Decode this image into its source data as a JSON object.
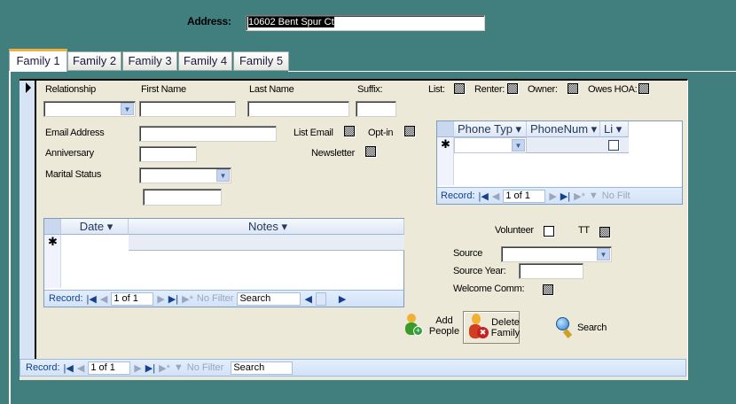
{
  "address": {
    "label": "Address:",
    "value": "10602 Bent Spur Ct"
  },
  "tabs": [
    "Family 1",
    "Family 2",
    "Family 3",
    "Family 4",
    "Family 5"
  ],
  "form": {
    "relationship_label": "Relationship",
    "first_name_label": "First Name",
    "last_name_label": "Last Name",
    "suffix_label": "Suffix:",
    "list_label": "List:",
    "renter_label": "Renter:",
    "owner_label": "Owner:",
    "owes_hoa_label": "Owes HOA:",
    "email_label": "Email Address",
    "list_email_label": "List Email",
    "optin_label": "Opt-in",
    "anniversary_label": "Anniversary",
    "newsletter_label": "Newsletter",
    "marital_label": "Marital Status",
    "volunteer_label": "Volunteer",
    "tt_label": "TT",
    "source_label": "Source",
    "source_year_label": "Source Year:",
    "welcome_label": "Welcome Comm:"
  },
  "phone_grid": {
    "columns": [
      "Phone Typ",
      "PhoneNum",
      "Li"
    ],
    "nav": {
      "record": "Record:",
      "position": "1 of 1",
      "filter": "No Filt"
    }
  },
  "notes_grid": {
    "columns": [
      "Date",
      "Notes"
    ],
    "nav": {
      "record": "Record:",
      "position": "1 of 1",
      "filter": "No Filter",
      "search": "Search"
    }
  },
  "buttons": {
    "add_people": [
      "Add",
      "People"
    ],
    "delete_family": [
      "Delete",
      "Family"
    ],
    "search": "Search"
  },
  "main_nav": {
    "record": "Record:",
    "position": "1 of 1",
    "filter": "No Filter",
    "search": "Search"
  }
}
